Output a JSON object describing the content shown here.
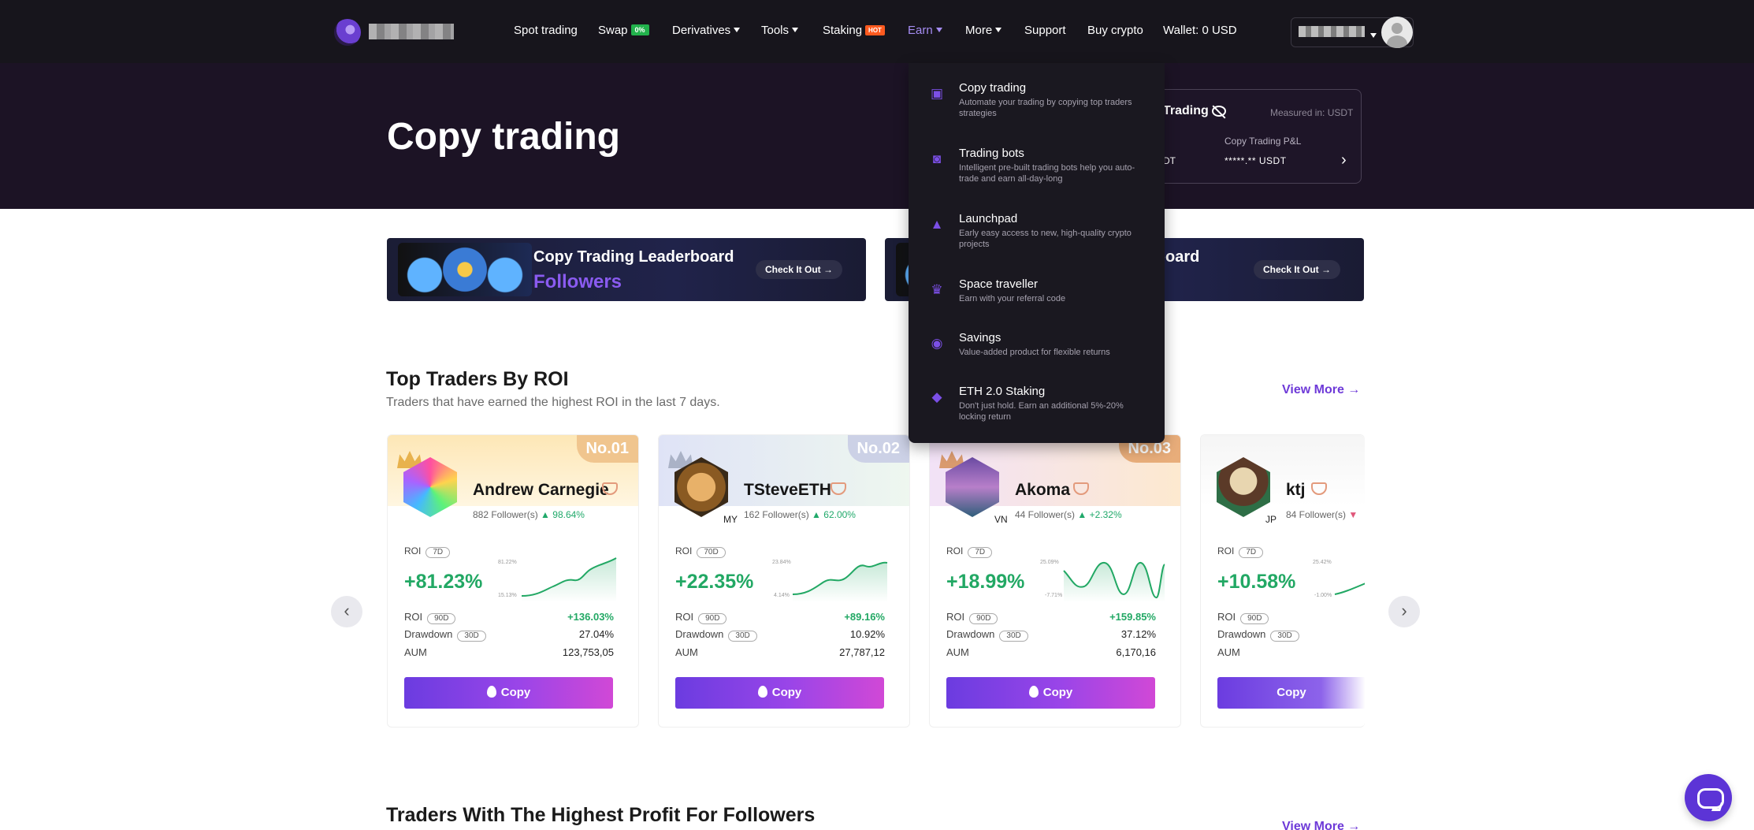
{
  "nav": {
    "items": [
      {
        "label": "Spot trading"
      },
      {
        "label": "Swap",
        "badge": "0%"
      },
      {
        "label": "Derivatives",
        "caret": true
      },
      {
        "label": "Tools",
        "caret": true
      },
      {
        "label": "Staking",
        "badge": "HOT"
      },
      {
        "label": "Earn",
        "caret": true,
        "active": true
      },
      {
        "label": "More",
        "caret": true
      },
      {
        "label": "Support"
      },
      {
        "label": "Buy crypto"
      },
      {
        "label": "Wallet: 0 USD"
      }
    ]
  },
  "hero": {
    "title": "Copy trading",
    "pnl_title": "Trading",
    "measured": "Measured in: USDT",
    "pnl_label": "Copy Trading P&L",
    "pnl_left": "DT",
    "pnl_value": "*****.** USDT"
  },
  "banners": [
    {
      "title": "Copy Trading Leaderboard",
      "subtitle": "Followers",
      "button": "Check It Out"
    },
    {
      "title": "rboard",
      "button": "Check It Out"
    }
  ],
  "top_traders": {
    "title": "Top Traders By ROI",
    "subtitle": "Traders that have earned the highest ROI in the last 7 days.",
    "view_more": "View More",
    "cards": [
      {
        "rank": "No.01",
        "name": "Andrew Carnegie",
        "followers": "882 Follower(s)",
        "follower_change": "98.64%",
        "roi_period": "7D",
        "roi": "+81.23%",
        "spark_max": "81.22%",
        "spark_min": "15.13%",
        "roi_90_label": "90D",
        "roi_90": "+136.03%",
        "drawdown_period": "30D",
        "drawdown": "27.04%",
        "aum": "123,753,05",
        "copy": "Copy"
      },
      {
        "rank": "No.02",
        "name": "TSteveETH",
        "country": "MY",
        "followers": "162 Follower(s)",
        "follower_change": "62.00%",
        "roi_period": "70D",
        "roi": "+22.35%",
        "spark_max": "23.84%",
        "spark_min": "4.14%",
        "roi_90_label": "90D",
        "roi_90": "+89.16%",
        "drawdown_period": "30D",
        "drawdown": "10.92%",
        "aum": "27,787,12",
        "copy": "Copy"
      },
      {
        "rank": "No.03",
        "name": "Akoma",
        "country": "VN",
        "followers": "44 Follower(s)",
        "follower_change": "+2.32%",
        "roi_period": "7D",
        "roi": "+18.99%",
        "spark_max": "25.09%",
        "spark_min": "-7.71%",
        "roi_90_label": "90D",
        "roi_90": "+159.85%",
        "drawdown_period": "30D",
        "drawdown": "37.12%",
        "aum": "6,170,16",
        "copy": "Copy"
      },
      {
        "rank": "",
        "name": "ktj",
        "country": "JP",
        "followers": "84 Follower(s)",
        "follower_change": "",
        "roi_period": "7D",
        "roi": "+10.58%",
        "spark_max": "25.42%",
        "spark_min": "-1.00%",
        "roi_90_label": "90D",
        "roi_90": "",
        "drawdown_period": "30D",
        "drawdown": "",
        "aum": "",
        "copy": "Copy"
      }
    ],
    "labels": {
      "roi": "ROI",
      "drawdown": "Drawdown",
      "aum": "AUM"
    }
  },
  "profit_section": {
    "title": "Traders With The Highest Profit For Followers",
    "view_more": "View More"
  },
  "earn_menu": [
    {
      "title": "Copy trading",
      "desc": "Automate your trading by copying top traders strategies",
      "icon": "copy-icon"
    },
    {
      "title": "Trading bots",
      "desc": "Intelligent pre-built trading bots help you auto-trade and earn all-day-long",
      "icon": "bot-icon"
    },
    {
      "title": "Launchpad",
      "desc": "Early easy access to new, high-quality crypto projects",
      "icon": "rocket-icon"
    },
    {
      "title": "Space traveller",
      "desc": "Earn with your referral code",
      "icon": "trophy-icon"
    },
    {
      "title": "Savings",
      "desc": "Value-added product for flexible returns",
      "icon": "coins-icon"
    },
    {
      "title": "ETH 2.0 Staking",
      "desc": "Don't just hold. Earn an additional 5%-20% locking return",
      "icon": "ethereum-icon"
    }
  ],
  "colors": {
    "accent": "#6e3ad8",
    "positive": "#22a864",
    "nav_bg": "#17151c"
  }
}
